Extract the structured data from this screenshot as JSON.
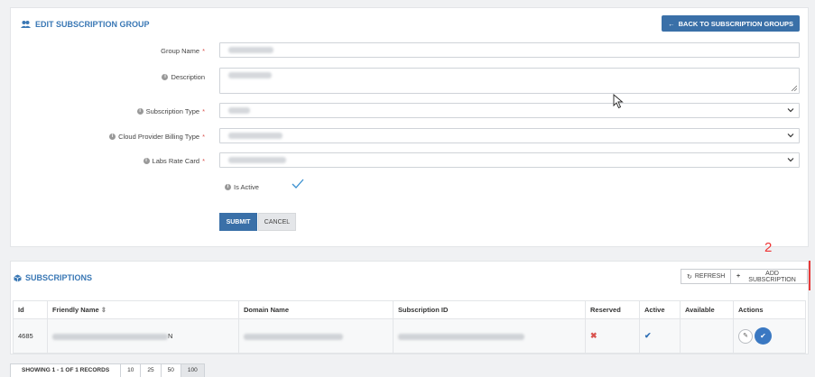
{
  "edit_panel": {
    "title": "EDIT SUBSCRIPTION GROUP",
    "back_button": "BACK TO SUBSCRIPTION GROUPS",
    "fields": {
      "group_name": "Group Name",
      "description": "Description",
      "subscription_type": "Subscription Type",
      "billing_type": "Cloud Provider Billing Type",
      "rate_card": "Labs Rate Card",
      "is_active": "Is Active"
    },
    "required_mark": "*",
    "submit": "SUBMIT",
    "cancel": "CANCEL"
  },
  "subscriptions": {
    "title": "SUBSCRIPTIONS",
    "refresh": "REFRESH",
    "add": "ADD SUBSCRIPTION",
    "columns": [
      "Id",
      "Friendly Name",
      "Domain Name",
      "Subscription ID",
      "Reserved",
      "Active",
      "Available",
      "Actions"
    ],
    "row": {
      "id": "4685",
      "friendly_name_suffix": "N"
    }
  },
  "annotation": {
    "number": "2"
  },
  "pager": {
    "info": "SHOWING 1 - 1 OF 1 RECORDS",
    "sizes": [
      "10",
      "25",
      "50",
      "100"
    ],
    "active_size": "100"
  },
  "colors": {
    "accent": "#3a78b5",
    "primary_button": "#3a70a8",
    "annotation": "#e63a3a"
  }
}
